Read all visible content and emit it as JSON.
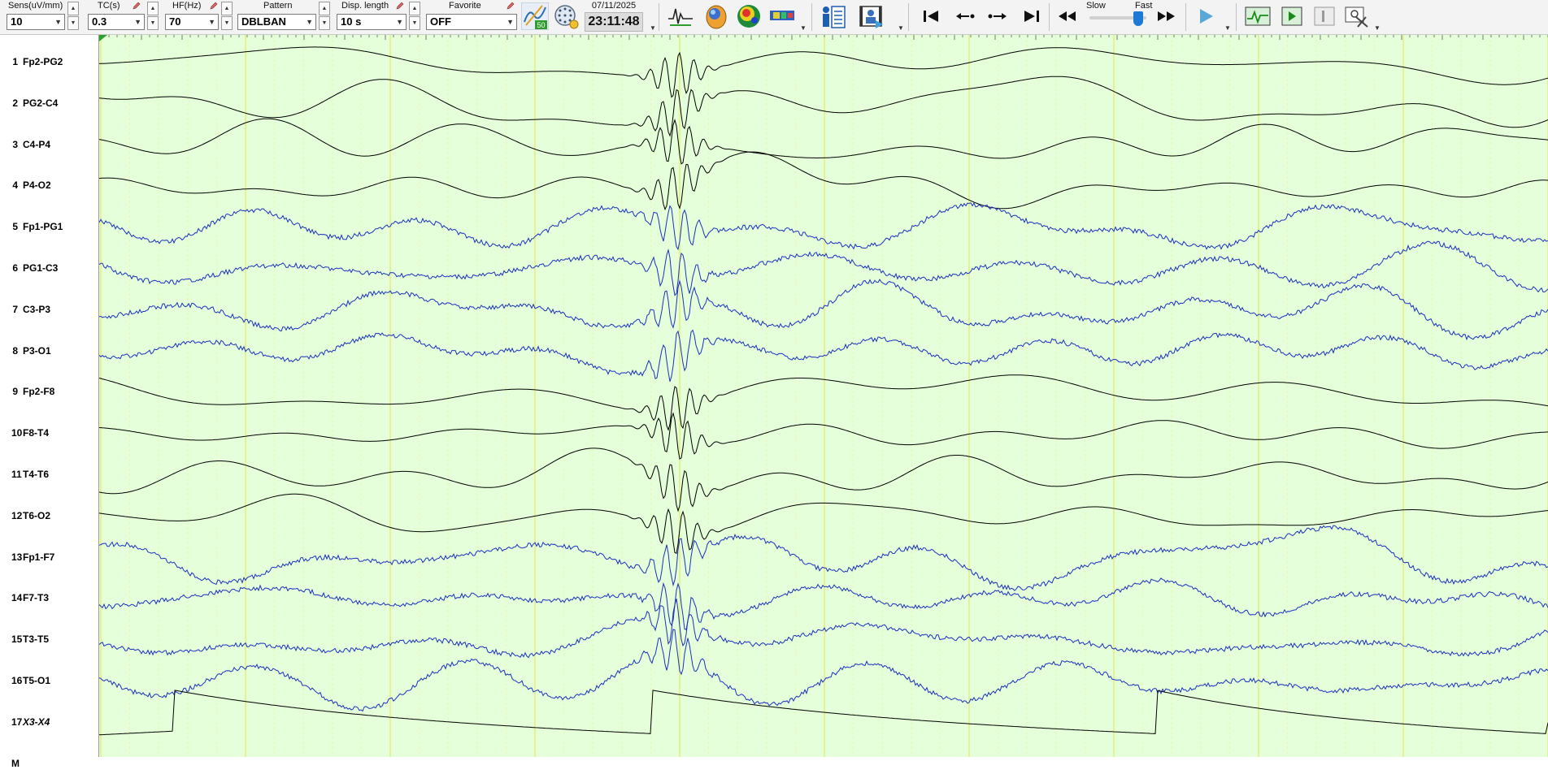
{
  "toolbar": {
    "sensitivity": {
      "label": "Sens(uV/mm)",
      "value": "10"
    },
    "tc": {
      "label": "TC(s)",
      "value": "0.3"
    },
    "hf": {
      "label": "HF(Hz)",
      "value": "70"
    },
    "pattern": {
      "label": "Pattern",
      "value": "DBLBAN"
    },
    "disp_length": {
      "label": "Disp. length",
      "value": "10 s"
    },
    "favorite": {
      "label": "Favorite",
      "value": "OFF"
    },
    "badge_50": "50",
    "date": "07/11/2025",
    "time": "23:11:48",
    "speed": {
      "slow": "Slow",
      "fast": "Fast",
      "level": 0.85
    },
    "icons": [
      "filter-settings-icon",
      "electrode-settings-icon",
      "waveform-icon",
      "head-map-icon",
      "topographic-map-icon",
      "spectrum-icon",
      "patient-info-icon",
      "video-panel-icon",
      "skip-to-start-icon",
      "step-back-icon",
      "step-forward-icon",
      "skip-to-end-icon",
      "rewind-icon",
      "fast-forward-icon",
      "play-icon",
      "montage-wave-icon",
      "next-page-icon",
      "prev-page-icon",
      "tools-icon"
    ]
  },
  "channels": [
    {
      "num": "1",
      "name": "Fp2-PG2",
      "color": "#000000"
    },
    {
      "num": "2",
      "name": "PG2-C4",
      "color": "#000000"
    },
    {
      "num": "3",
      "name": "C4-P4",
      "color": "#000000"
    },
    {
      "num": "4",
      "name": "P4-O2",
      "color": "#000000"
    },
    {
      "num": "5",
      "name": "Fp1-PG1",
      "color": "#1a2fc2"
    },
    {
      "num": "6",
      "name": "PG1-C3",
      "color": "#1a2fc2"
    },
    {
      "num": "7",
      "name": "C3-P3",
      "color": "#1a2fc2"
    },
    {
      "num": "8",
      "name": "P3-O1",
      "color": "#1a2fc2"
    },
    {
      "num": "9",
      "name": "Fp2-F8",
      "color": "#000000"
    },
    {
      "num": "10",
      "name": "F8-T4",
      "color": "#000000"
    },
    {
      "num": "11",
      "name": "T4-T6",
      "color": "#000000"
    },
    {
      "num": "12",
      "name": "T6-O2",
      "color": "#000000"
    },
    {
      "num": "13",
      "name": "Fp1-F7",
      "color": "#1a2fc2"
    },
    {
      "num": "14",
      "name": "F7-T3",
      "color": "#1a2fc2"
    },
    {
      "num": "15",
      "name": "T3-T5",
      "color": "#1a2fc2"
    },
    {
      "num": "16",
      "name": "T5-O1",
      "color": "#1a2fc2"
    },
    {
      "num": "17",
      "name": "X3-X4",
      "color": "#000000",
      "italic": true
    },
    {
      "num": "M",
      "name": "",
      "color": "#000000"
    }
  ],
  "colors": {
    "background": "#e4ffd9",
    "second_line": "#e6e64a",
    "minor_line": "#f2f2a6"
  }
}
